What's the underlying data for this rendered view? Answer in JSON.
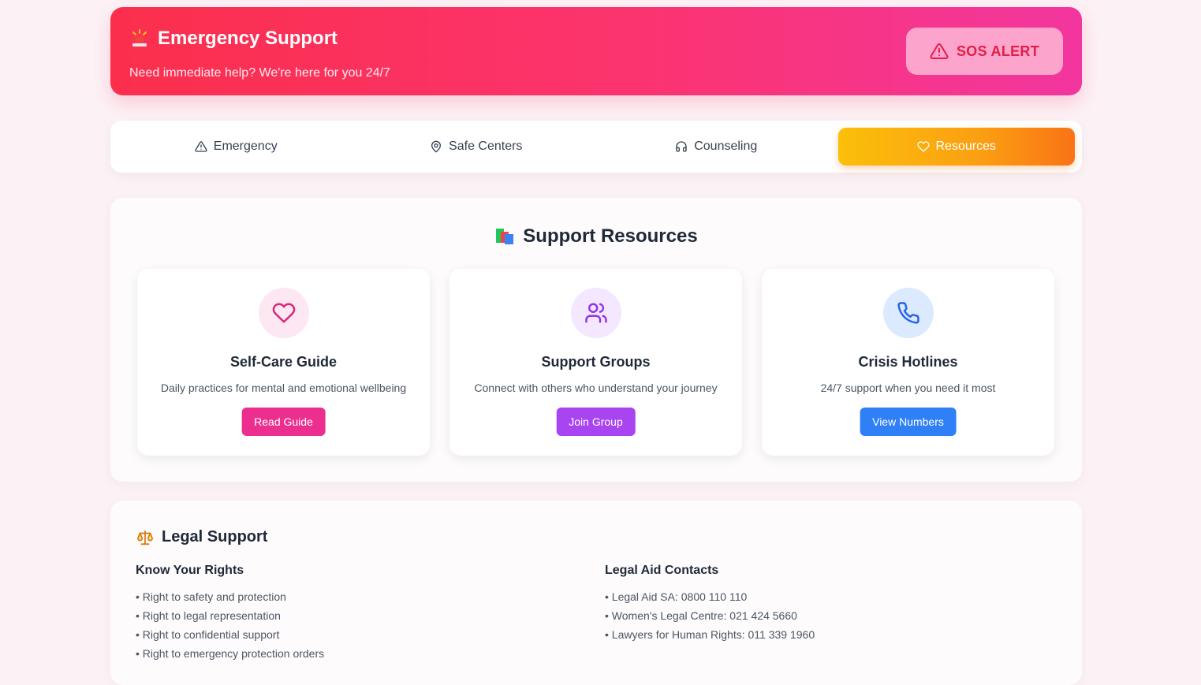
{
  "header": {
    "title": "Emergency Support",
    "subtitle": "Need immediate help? We're here for you 24/7",
    "icon": "siren-icon",
    "sos_label": "SOS ALERT"
  },
  "tabs": [
    {
      "label": "Emergency",
      "icon": "alert-triangle-icon",
      "active": false
    },
    {
      "label": "Safe Centers",
      "icon": "map-pin-icon",
      "active": false
    },
    {
      "label": "Counseling",
      "icon": "headphones-icon",
      "active": false
    },
    {
      "label": "Resources",
      "icon": "heart-icon",
      "active": true
    }
  ],
  "resources": {
    "title": "Support Resources",
    "title_icon": "books-icon",
    "cards": [
      {
        "title": "Self-Care Guide",
        "description": "Daily practices for mental and emotional wellbeing",
        "button": "Read Guide",
        "icon": "heart-icon",
        "color": "#ec2f8f",
        "icon_bg": "#fce7f3"
      },
      {
        "title": "Support Groups",
        "description": "Connect with others who understand your journey",
        "button": "Join Group",
        "icon": "users-icon",
        "color": "#a844f0",
        "icon_bg": "#f3e8ff"
      },
      {
        "title": "Crisis Hotlines",
        "description": "24/7 support when you need it most",
        "button": "View Numbers",
        "icon": "phone-icon",
        "color": "#2f80f7",
        "icon_bg": "#dbeafe"
      }
    ]
  },
  "legal": {
    "title": "Legal Support",
    "title_icon": "scales-icon",
    "rights": {
      "heading": "Know Your Rights",
      "items": [
        "• Right to safety and protection",
        "• Right to legal representation",
        "• Right to confidential support",
        "• Right to emergency protection orders"
      ]
    },
    "contacts": {
      "heading": "Legal Aid Contacts",
      "items": [
        "• Legal Aid SA: 0800 110 110",
        "• Women's Legal Centre: 021 424 5660",
        "• Lawyers for Human Rights: 011 339 1960"
      ]
    }
  }
}
